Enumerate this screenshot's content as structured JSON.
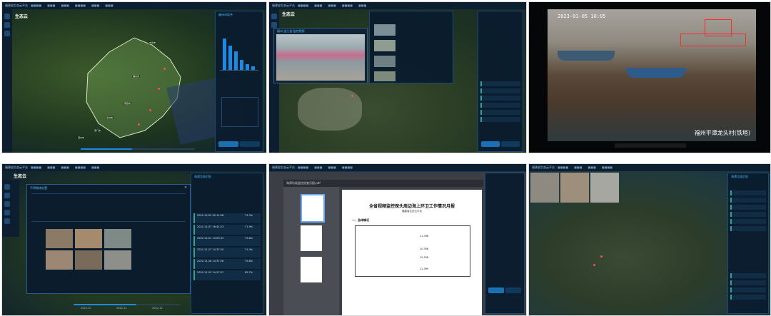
{
  "panels": {
    "p1": {
      "window_title": "福建省生态云平台",
      "app_name": "生态云",
      "region_tags": [
        "宁德市",
        "福州市",
        "莆田市",
        "泉州市",
        "厦门市",
        "漳州市"
      ],
      "right_panel_title": "福州市综合"
    },
    "p2": {
      "window_title": "福建省生态云平台",
      "app_name": "生态云",
      "video_title": "福州 连江县 监控视频"
    },
    "p3": {
      "timestamp": "2023-01-05 10:05",
      "watermark": "福州平潭龙头村(铁塔)"
    },
    "p4": {
      "window_title": "福建省生态云平台",
      "app_name": "生态云",
      "detail_title": "不明物体处置",
      "right_panel_title": "海漂垃圾识别",
      "list_dates": [
        "2022-12-02 09:11:58",
        "2022-12-07 16:41:23",
        "2022-12-01 10:09:43",
        "2022-11-27 14:37:20",
        "2022-11-28 14:37:28",
        "2022-11-25 14:27:57"
      ],
      "list_scores": [
        "75.3%",
        "71.9%",
        "75.8%",
        "71.4%",
        "75.8%",
        "65.7%"
      ],
      "timeline_labels": [
        "2022-10",
        "2022-11",
        "2022-12"
      ]
    },
    "p5": {
      "window_title": "福建省生态云平台",
      "pdf_file": "海漂垃圾监控巡查月报.pdf",
      "doc_title": "全省视频监控探头周边海上环卫工作情况月报",
      "doc_subtitle": "福建省生态云平台",
      "section": "一、总体情况",
      "table_values": [
        "11,398",
        "10,358",
        "10,158",
        "11,399"
      ]
    },
    "p6": {
      "window_title": "福建省生态云平台",
      "right_panel_title": "海漂垃圾识别"
    }
  },
  "colors": {
    "accent": "#4fc3f7",
    "active_bar": "#1e88e5",
    "panel_bg": "#0a1c2e",
    "alert": "#ff4d4d",
    "doc_bg": "#ffffff"
  }
}
